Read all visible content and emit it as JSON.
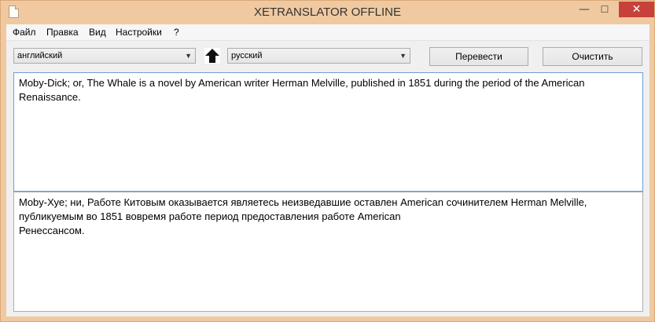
{
  "window": {
    "title": "XETRANSLATOR OFFLINE",
    "controls": {
      "minimize": "—",
      "maximize": "☐",
      "close": "✕"
    }
  },
  "menu": {
    "items": [
      "Файл",
      "Правка",
      "Вид",
      "Настройки",
      "?"
    ]
  },
  "toolbar": {
    "source_language": "английский",
    "target_language": "русский",
    "translate_label": "Перевести",
    "clear_label": "Очистить"
  },
  "source_text": "Moby-Dick; or, The Whale is a novel by American writer Herman Melville, published in 1851 during the period of the American Renaissance.",
  "translated_text": "Moby-Хуе; ни, Работе Китовым оказывается являетесь неизведавшие оставлен American сочинителем Herman Melville, публикуемым во 1851 вовремя работе период предоставления работе American\nРенессансом.",
  "colors": {
    "frame": "#f0c9a0",
    "close_button": "#c7413a",
    "focus_border": "#6d9dd3"
  }
}
